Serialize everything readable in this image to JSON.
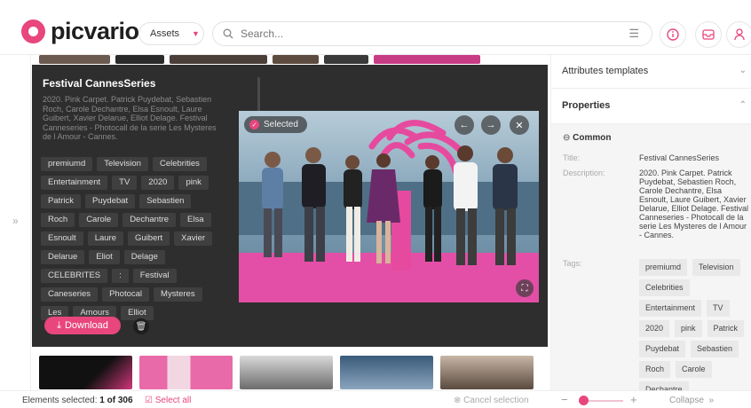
{
  "app": {
    "logo": "picvario"
  },
  "topbar": {
    "assets_label": "Assets",
    "search_placeholder": "Search..."
  },
  "panel": {
    "title": "Festival CannesSeries",
    "description": "2020. Pink Carpet. Patrick Puydebat, Sebastien Roch, Carole Dechantre, Elsa Esnoult, Laure Guibert, Xavier Delarue, Elliot Delage. Festival Canneseries - Photocall de la serie Les Mysteres de l Amour - Cannes.",
    "tags": [
      "premiumd",
      "Television",
      "Celebrities",
      "Entertainment",
      "TV",
      "2020",
      "pink",
      "Patrick",
      "Puydebat",
      "Sebastien",
      "Roch",
      "Carole",
      "Dechantre",
      "Elsa",
      "Esnoult",
      "Laure",
      "Guibert",
      "Xavier",
      "Delarue",
      "Eliot",
      "Delage",
      "CELEBRITES",
      ":",
      "Festival",
      "Caneseries",
      "Photocal",
      "Mysteres",
      "Les",
      "Amours",
      "Elliot"
    ],
    "download_label": "Download",
    "selected_label": "Selected"
  },
  "status": {
    "elements_selected_prefix": "Elements selected:",
    "count": "1 of 306",
    "select_all": "Select all",
    "cancel": "Cancel selection"
  },
  "right": {
    "attributes_templates": "Attributes templates",
    "properties": "Properties",
    "common": "Common",
    "title_label": "Title:",
    "title_value": "Festival CannesSeries",
    "description_label": "Description:",
    "description_value": "2020. Pink Carpet. Patrick Puydebat, Sebastien Roch, Carole Dechantre, Elsa Esnoult, Laure Guibert, Xavier Delarue, Elliot Delage. Festival Canneseries - Photocall de la serie Les Mysteres de l Amour - Cannes.",
    "tags_label": "Tags:",
    "tags": [
      "premiumd",
      "Television",
      "Celebrities",
      "Entertainment",
      "TV",
      "2020",
      "pink",
      "Patrick",
      "Puydebat",
      "Sebastien",
      "Roch",
      "Carole",
      "Dechantre"
    ]
  },
  "zoom": {
    "collapse_label": "Collapse"
  },
  "colors": {
    "accent": "#e8467c",
    "panel_bg": "#2e2e2e"
  }
}
